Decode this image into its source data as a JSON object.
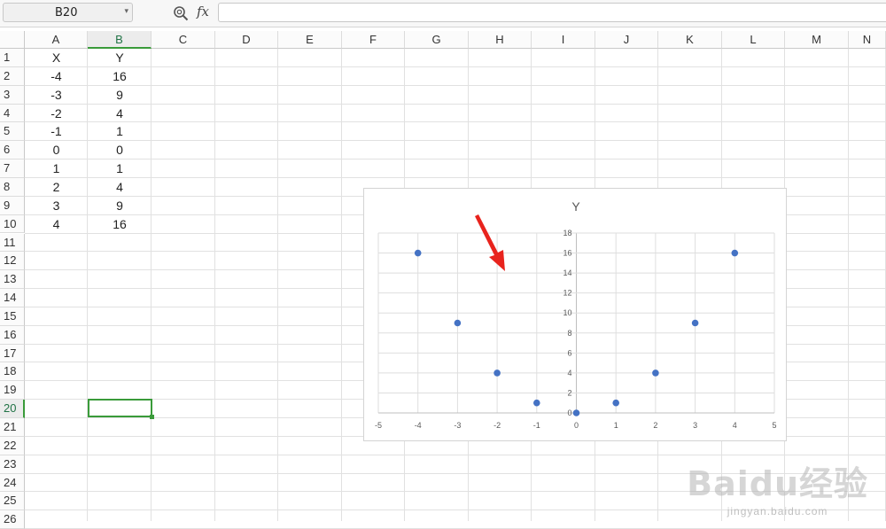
{
  "formula_bar": {
    "name_box": "B20",
    "fx_label": "fx",
    "formula": ""
  },
  "columns": [
    "A",
    "B",
    "C",
    "D",
    "E",
    "F",
    "G",
    "H",
    "I",
    "J",
    "K",
    "L",
    "M",
    "N"
  ],
  "selected_column": "B",
  "rows": [
    "1",
    "2",
    "3",
    "4",
    "5",
    "6",
    "7",
    "8",
    "9",
    "10",
    "11",
    "12",
    "13",
    "14",
    "15",
    "16",
    "17",
    "18",
    "19",
    "20",
    "21",
    "22",
    "23",
    "24",
    "25",
    "26"
  ],
  "selected_row": "20",
  "cells": {
    "A": [
      "X",
      "-4",
      "-3",
      "-2",
      "-1",
      "0",
      "1",
      "2",
      "3",
      "4"
    ],
    "B": [
      "Y",
      "16",
      "9",
      "4",
      "1",
      "0",
      "1",
      "4",
      "9",
      "16"
    ]
  },
  "chart_data": {
    "type": "scatter",
    "title": "Y",
    "x": [
      -4,
      -3,
      -2,
      -1,
      0,
      1,
      2,
      3,
      4
    ],
    "y": [
      16,
      9,
      4,
      1,
      0,
      1,
      4,
      9,
      16
    ],
    "xlim": [
      -5,
      5
    ],
    "ylim": [
      0,
      18
    ],
    "xticks": [
      "-5",
      "-4",
      "-3",
      "-2",
      "-1",
      "0",
      "1",
      "2",
      "3",
      "4",
      "5"
    ],
    "yticks": [
      "0",
      "2",
      "4",
      "6",
      "8",
      "10",
      "12",
      "14",
      "16",
      "18"
    ],
    "grid": true,
    "marker_color": "#4472c4"
  },
  "annotation": {
    "arrow_color": "#e8231d"
  },
  "watermark": {
    "logo": "Baidu经验",
    "url": "jingyan.baidu.com"
  }
}
